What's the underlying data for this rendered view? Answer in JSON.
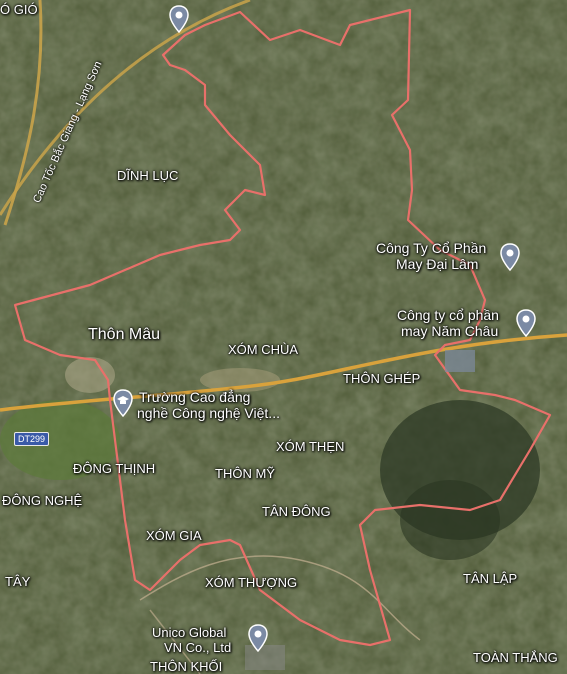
{
  "places": {
    "dong_gio": "Ó GIÓ",
    "dinh_luc": "DĨNH LỤC",
    "thon_mau": "Thôn Mâu",
    "xom_chua": "XÓM CHÙA",
    "thon_ghep": "THÔN GHÉP",
    "xom_then": "XÓM THẸN",
    "thon_my": "THÔN MỸ",
    "dong_thinh": "ĐÔNG THỊNH",
    "dong_nghe": "ĐÔNG NGHỆ",
    "tan_dong": "TÂN ĐÔNG",
    "xom_gia": "XÓM GIA",
    "xom_thuong": "XÓM THƯỢNG",
    "tay": "TÂY",
    "tan_lap": "TÂN LẬP",
    "toan_thang": "TOÀN THẮNG",
    "thon_khoi": "THÔN KHỐI"
  },
  "pois": {
    "dai_lam": [
      "Công Ty Cổ Phần",
      "May Đại Lâm"
    ],
    "nam_chau": [
      "Công ty cổ phần",
      "may Năm Châu"
    ],
    "truong": [
      "Trường Cao đẳng",
      "nghề Công nghệ Việt..."
    ],
    "unico": [
      "Unico Global",
      "VN Co., Ltd"
    ]
  },
  "roads": {
    "highway": "Cao Tốc Bắc Giang - Lạng Sơn",
    "dt299": "DT299"
  },
  "colors": {
    "boundary": "#e8706a",
    "road": "#d9a23c",
    "label": "#ffffff"
  }
}
